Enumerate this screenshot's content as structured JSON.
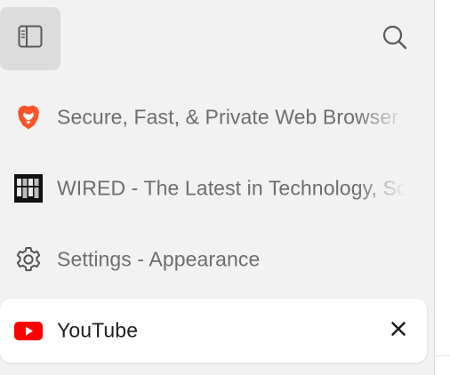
{
  "toolbar": {
    "sidebar_toggle_icon": "sidebar-icon",
    "search_icon": "search-icon"
  },
  "tabs": [
    {
      "title": "Secure, Fast, & Private Web Browser with Adblocker | Brave",
      "favicon": "brave-lion-icon",
      "active": false
    },
    {
      "title": "WIRED - The Latest in Technology, Science, Culture and Business",
      "favicon": "wired-logo-icon",
      "active": false
    },
    {
      "title": "Settings - Appearance",
      "favicon": "gear-icon",
      "active": false
    },
    {
      "title": "YouTube",
      "favicon": "youtube-icon",
      "active": true,
      "close_icon": "close-icon"
    }
  ],
  "colors": {
    "sidebar_bg": "#f2f2f2",
    "active_tab_bg": "#ffffff",
    "brave_orange": "#fb542b",
    "youtube_red": "#ff0000",
    "text_muted": "#6e6e6e",
    "text_active": "#1f1f1f"
  }
}
